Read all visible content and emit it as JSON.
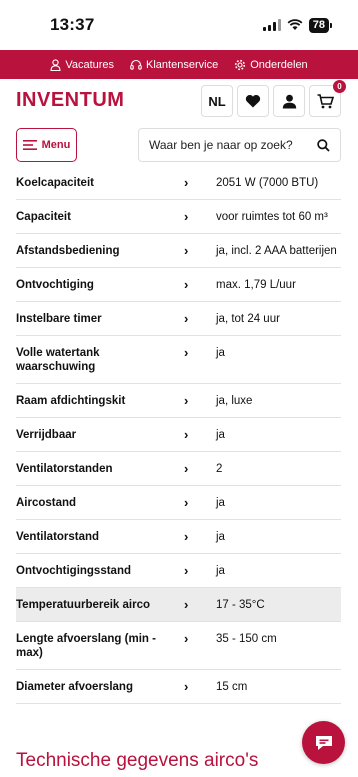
{
  "status_bar": {
    "time": "13:37",
    "battery": "78"
  },
  "topbar": {
    "links": [
      {
        "label": "Vacatures",
        "icon": "person-icon"
      },
      {
        "label": "Klantenservice",
        "icon": "headset-icon"
      },
      {
        "label": "Onderdelen",
        "icon": "gear-icon"
      }
    ]
  },
  "header": {
    "logo": "INVENTUM",
    "language": "NL",
    "cart_count": "0"
  },
  "nav": {
    "menu_label": "Menu",
    "search_placeholder": "Waar ben je naar op zoek?"
  },
  "specs": [
    {
      "label": "Koelcapaciteit",
      "value": "2051 W (7000 BTU)"
    },
    {
      "label": "Capaciteit",
      "value": "voor ruimtes tot 60 m³"
    },
    {
      "label": "Afstandsbediening",
      "value": "ja, incl. 2 AAA batterijen"
    },
    {
      "label": "Ontvochtiging",
      "value": "max. 1,79 L/uur"
    },
    {
      "label": "Instelbare timer",
      "value": "ja, tot 24 uur"
    },
    {
      "label": "Volle watertank waarschuwing",
      "value": "ja"
    },
    {
      "label": "Raam afdichtingskit",
      "value": "ja, luxe"
    },
    {
      "label": "Verrijdbaar",
      "value": "ja"
    },
    {
      "label": "Ventilatorstanden",
      "value": "2"
    },
    {
      "label": "Aircostand",
      "value": "ja"
    },
    {
      "label": "Ventilatorstand",
      "value": "ja"
    },
    {
      "label": "Ontvochtigingsstand",
      "value": "ja"
    },
    {
      "label": "Temperatuurbereik airco",
      "value": "17 - 35°C",
      "highlighted": true
    },
    {
      "label": "Lengte afvoerslang (min - max)",
      "value": "35 - 150 cm"
    },
    {
      "label": "Diameter afvoerslang",
      "value": "15 cm"
    }
  ],
  "chevron": "›",
  "section_heading": "Technische gegevens airco's",
  "colors": {
    "brand": "#b8123d"
  }
}
